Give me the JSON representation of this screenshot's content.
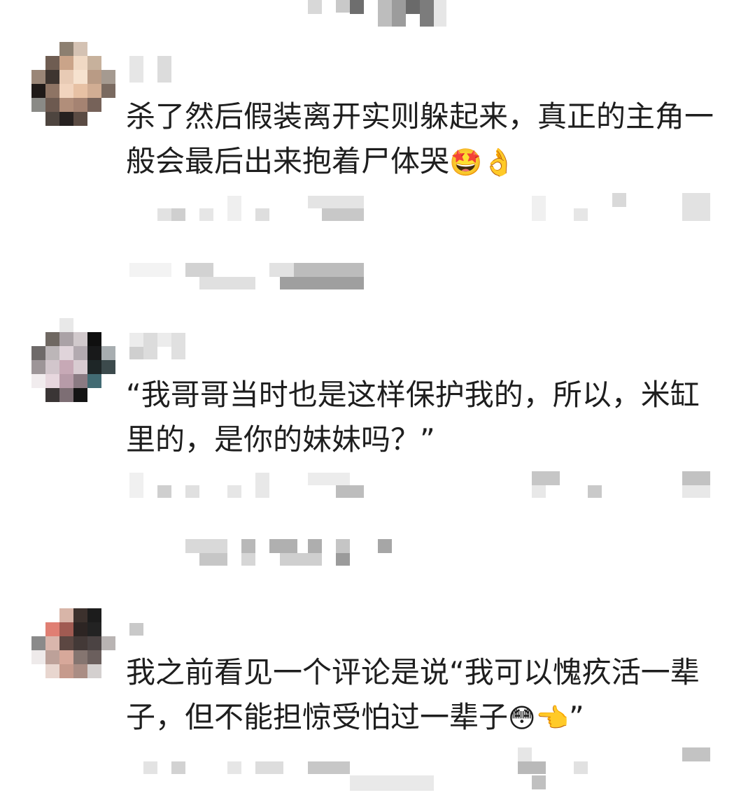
{
  "comments": [
    {
      "text": "杀了然后假装离开实则躲起来，真正的主角一般会最后出来抱着尸体哭",
      "emojis": [
        "🤩",
        "👌"
      ]
    },
    {
      "text": "“我哥哥当时也是这样保护我的，所以，米缸里的，是你的妹妹吗？”",
      "emojis": []
    },
    {
      "text": "我之前看见一个评论是说“我可以愧疚活一辈子，但不能担惊受怕过一辈子",
      "emojis": [
        "😳",
        "👈"
      ],
      "suffix": "”"
    }
  ]
}
